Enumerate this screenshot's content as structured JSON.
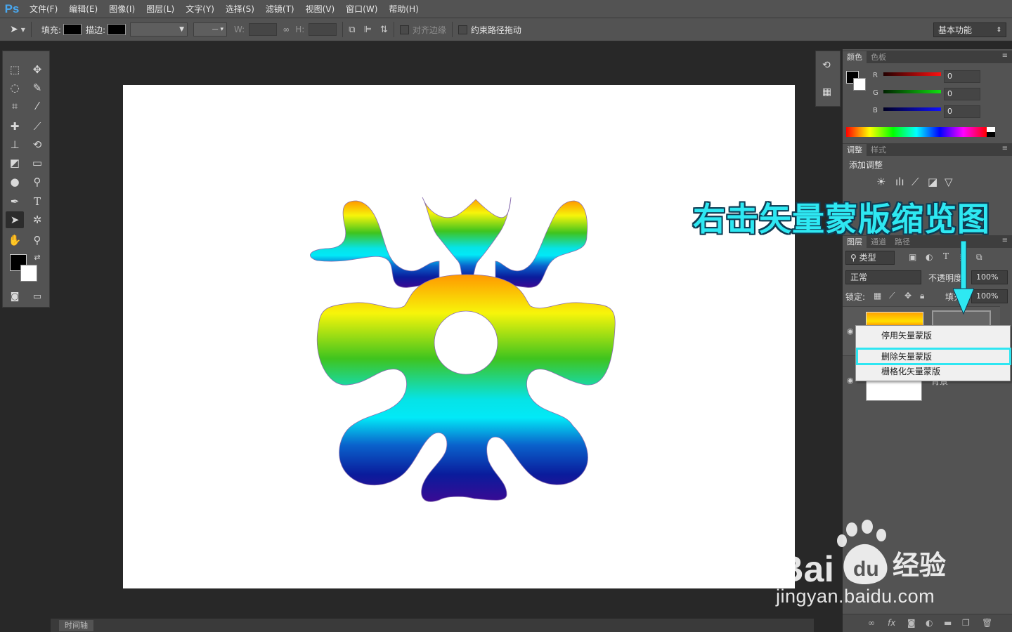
{
  "app": {
    "logo": "Ps"
  },
  "menu": [
    "文件(F)",
    "编辑(E)",
    "图像(I)",
    "图层(L)",
    "文字(Y)",
    "选择(S)",
    "滤镜(T)",
    "视图(V)",
    "窗口(W)",
    "帮助(H)"
  ],
  "options": {
    "fill_label": "填充:",
    "stroke_label": "描边:",
    "w_label": "W:",
    "h_label": "H:",
    "align_edges": "对齐边缘",
    "constrain_path": "约束路径拖动",
    "workspace": "基本功能"
  },
  "color_panel": {
    "tabs": [
      "颜色",
      "色板"
    ],
    "r_label": "R",
    "g_label": "G",
    "b_label": "B",
    "r": "0",
    "g": "0",
    "b": "0"
  },
  "adjust_panel": {
    "tabs": [
      "调整",
      "样式"
    ],
    "title": "添加调整"
  },
  "layers_panel": {
    "tabs": [
      "图层",
      "通道",
      "路径"
    ],
    "filter_kind": "类型",
    "blend_mode": "正常",
    "opacity_label": "不透明度:",
    "opacity": "100%",
    "lock_label": "锁定:",
    "fill_label": "填充:",
    "fill": "100%",
    "background_layer_name": "背景"
  },
  "context_menu": {
    "items": [
      "停用矢量蒙版",
      "删除矢量蒙版",
      "栅格化矢量蒙版"
    ],
    "highlighted": "删除矢量蒙版"
  },
  "annotation": {
    "text": "右击矢量蒙版缩览图",
    "color": "#2ee8f2"
  },
  "timeline": {
    "tab": "时间轴"
  },
  "watermark": {
    "brand": "Bai du 经验",
    "url": "jingyan.baidu.com"
  },
  "colors": {
    "accent": "#2ee8f2",
    "ui_bg": "#535353",
    "canvas_bg": "#282828"
  },
  "icons": [
    "move-tool-icon",
    "marquee-icon",
    "lasso-icon",
    "crop-icon",
    "brush-icon",
    "eraser-icon",
    "pen-icon",
    "type-icon",
    "hand-icon",
    "zoom-icon",
    "lock-icon",
    "eye-icon"
  ]
}
